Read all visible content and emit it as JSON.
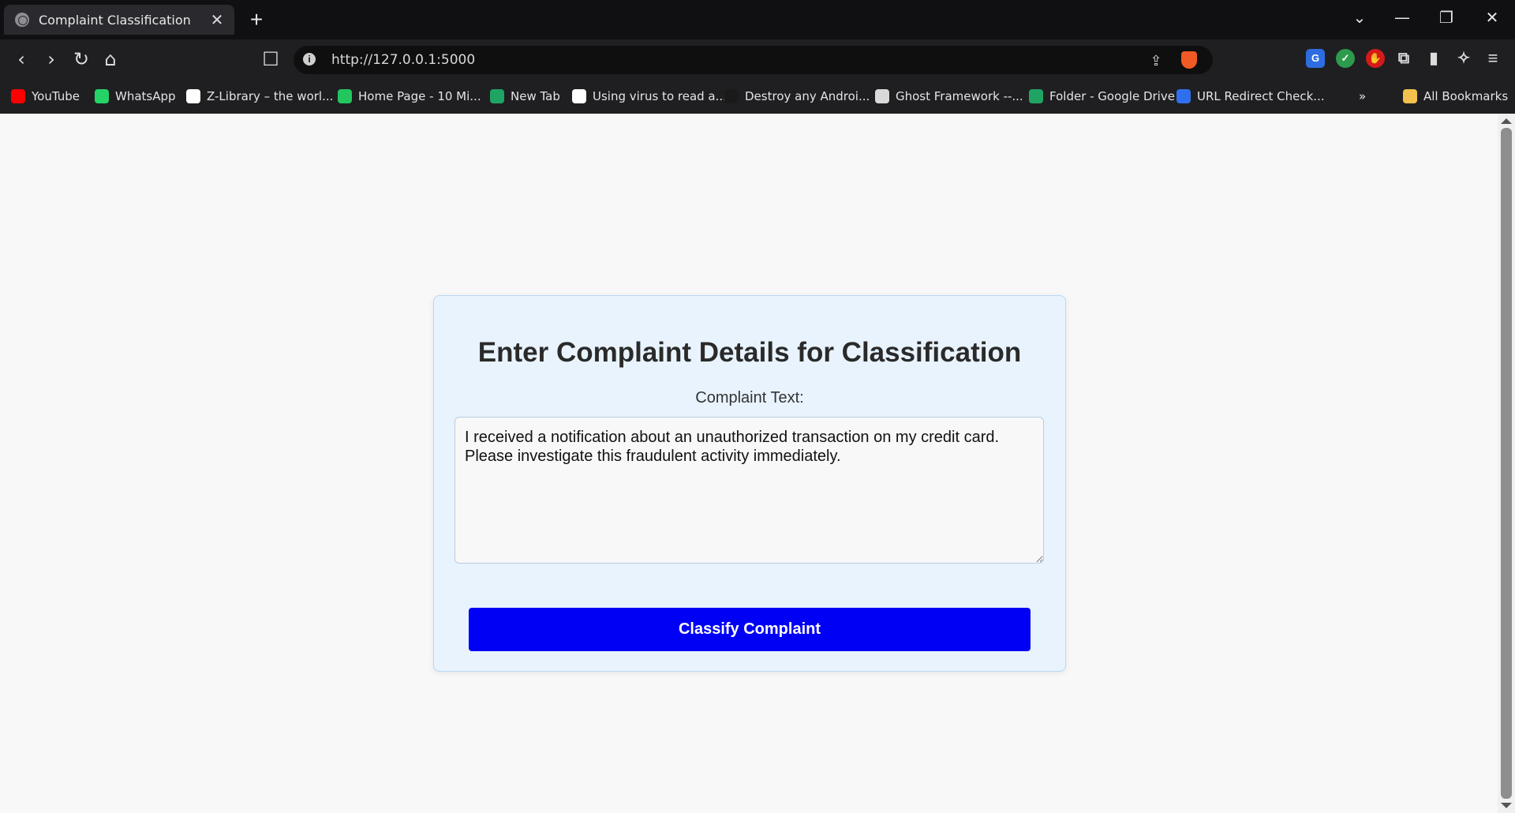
{
  "browser": {
    "tab_title": "Complaint Classification",
    "url": "http://127.0.0.1:5000",
    "new_tab_label": "+",
    "close_label": "✕"
  },
  "bookmarks": [
    {
      "label": "YouTube",
      "color": "#ff0000"
    },
    {
      "label": "WhatsApp",
      "color": "#25d366"
    },
    {
      "label": "Z-Library – the worl...",
      "color": "#ffffff"
    },
    {
      "label": "Home Page - 10 Mi...",
      "color": "#22c55e"
    },
    {
      "label": "New Tab",
      "color": "#1fa463"
    },
    {
      "label": "Using virus to read a...",
      "color": "#ffffff"
    },
    {
      "label": "Destroy any Androi...",
      "color": "#1a1a1a"
    },
    {
      "label": "Ghost Framework --...",
      "color": "#d9d9d9"
    },
    {
      "label": "Folder - Google Drive",
      "color": "#1fa463"
    },
    {
      "label": "URL Redirect Check...",
      "color": "#2f6fed"
    }
  ],
  "all_bookmarks_label": "All Bookmarks",
  "form": {
    "heading": "Enter Complaint Details for Classification",
    "label": "Complaint Text:",
    "complaint_text": "I received a notification about an unauthorized transaction on my credit card.\nPlease investigate this fraudulent activity immediately.",
    "button_label": "Classify Complaint",
    "button_color": "#0000f5",
    "card_color": "#e8f3fe"
  }
}
